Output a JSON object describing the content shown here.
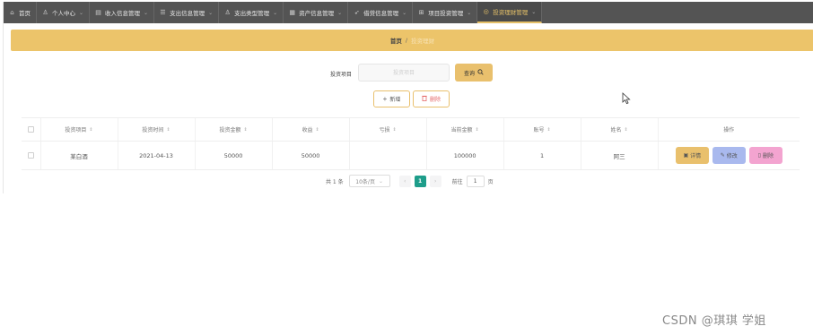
{
  "nav": {
    "items": [
      {
        "icon": "home-icon",
        "label": "首页",
        "caret": false
      },
      {
        "icon": "user-icon",
        "label": "个人中心",
        "caret": true
      },
      {
        "icon": "income-icon",
        "label": "收入信息管理",
        "caret": true
      },
      {
        "icon": "list-icon",
        "label": "支出信息管理",
        "caret": true
      },
      {
        "icon": "person-icon",
        "label": "支出类型管理",
        "caret": true
      },
      {
        "icon": "asset-icon",
        "label": "资产信息管理",
        "caret": true
      },
      {
        "icon": "send-icon",
        "label": "借贷信息管理",
        "caret": true
      },
      {
        "icon": "grid-icon",
        "label": "项目投资管理",
        "caret": true
      },
      {
        "icon": "finance-icon",
        "label": "投资理财管理",
        "caret": true,
        "active": true
      }
    ],
    "accent_color": "#e5c068"
  },
  "breadcrumb": {
    "home": "首页",
    "separator": "/",
    "current": "投资理财"
  },
  "search": {
    "label": "投资项目",
    "placeholder": "投资项目",
    "button": "查询"
  },
  "actions": {
    "add": "新增",
    "delete": "删除"
  },
  "table": {
    "headers": [
      "投资项目",
      "投资时间",
      "投资金额",
      "收益",
      "亏损",
      "当前金额",
      "账号",
      "姓名",
      "操作"
    ],
    "rows": [
      {
        "cells": [
          "某白酒",
          "2021-04-13",
          "50000",
          "50000",
          "",
          "100000",
          "1",
          "阿三"
        ],
        "ops": {
          "detail": "详情",
          "edit": "修改",
          "delete": "删除"
        }
      }
    ]
  },
  "pager": {
    "total": "共 1 条",
    "page_size": "10条/页",
    "current_page": "1",
    "goto_label": "前往",
    "goto_value": "1",
    "page_unit": "页"
  },
  "watermark": "CSDN @琪琪 学姐"
}
